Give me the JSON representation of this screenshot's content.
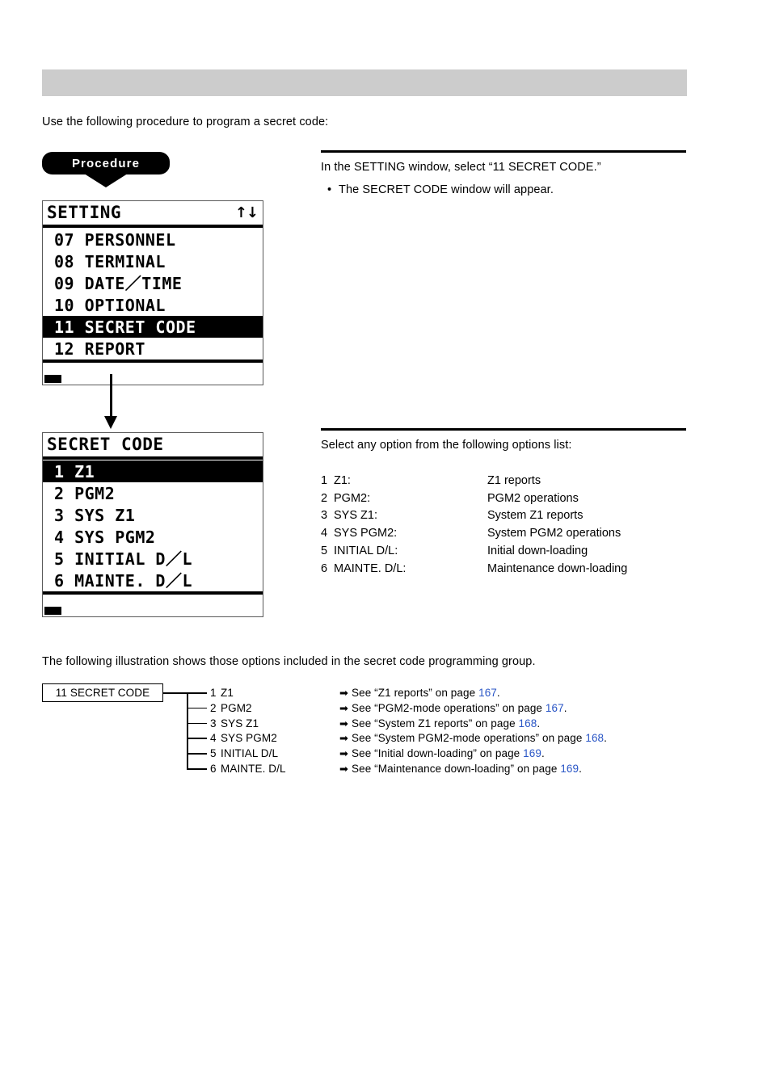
{
  "header": {
    "bar_color": "#cccccc",
    "title": ""
  },
  "intro_text": "Use the following procedure to program a secret code:",
  "procedure_badge": {
    "label": "Procedure"
  },
  "lcd_setting": {
    "title": "SETTING",
    "arrows": "↑↓",
    "rows": [
      {
        "label": "07 PERSONNEL",
        "selected": false
      },
      {
        "label": "08 TERMINAL",
        "selected": false
      },
      {
        "label": "09 DATE／TIME",
        "selected": false
      },
      {
        "label": "10 OPTIONAL",
        "selected": false
      },
      {
        "label": "11 SECRET CODE",
        "selected": true
      },
      {
        "label": "12 REPORT",
        "selected": false
      }
    ]
  },
  "lcd_secret": {
    "title": "SECRET CODE",
    "arrows": "",
    "rows": [
      {
        "label": "1 Z1",
        "selected": true
      },
      {
        "label": "2 PGM2",
        "selected": false
      },
      {
        "label": "3 SYS Z1",
        "selected": false
      },
      {
        "label": "4 SYS PGM2",
        "selected": false
      },
      {
        "label": "5 INITIAL D／L",
        "selected": false
      },
      {
        "label": "6 MAINTE. D／L",
        "selected": false
      }
    ]
  },
  "instruction_1": {
    "line": "In the SETTING window, select “11 SECRET CODE.”",
    "bullet_dot": "•",
    "bullet": "The SECRET CODE window will appear."
  },
  "instruction_2": {
    "line": "Select any option from the following options list:"
  },
  "options": [
    {
      "num": "1",
      "key": "Z1:",
      "desc": "Z1 reports"
    },
    {
      "num": "2",
      "key": "PGM2:",
      "desc": "PGM2 operations"
    },
    {
      "num": "3",
      "key": "SYS Z1:",
      "desc": "System Z1 reports"
    },
    {
      "num": "4",
      "key": "SYS PGM2:",
      "desc": "System PGM2 operations"
    },
    {
      "num": "5",
      "key": "INITIAL D/L:",
      "desc": "Initial down-loading"
    },
    {
      "num": "6",
      "key": "MAINTE. D/L:",
      "desc": "Maintenance down-loading"
    }
  ],
  "illustration_intro": "The following illustration shows those options included in the secret code programming group.",
  "tree": {
    "root_label": "11 SECRET CODE",
    "arrow_glyph": "➡",
    "branches": [
      {
        "num": "1",
        "label": "Z1",
        "ref_pre": "See “Z1 reports” on page ",
        "page": "167",
        "ref_post": "."
      },
      {
        "num": "2",
        "label": "PGM2",
        "ref_pre": "See “PGM2-mode operations” on page ",
        "page": "167",
        "ref_post": "."
      },
      {
        "num": "3",
        "label": "SYS Z1",
        "ref_pre": "See “System Z1 reports” on page ",
        "page": "168",
        "ref_post": "."
      },
      {
        "num": "4",
        "label": "SYS PGM2",
        "ref_pre": "See “System PGM2-mode operations” on page ",
        "page": "168",
        "ref_post": "."
      },
      {
        "num": "5",
        "label": "INITIAL D/L",
        "ref_pre": "See “Initial down-loading” on page ",
        "page": "169",
        "ref_post": "."
      },
      {
        "num": "6",
        "label": "MAINTE. D/L",
        "ref_pre": "See “Maintenance down-loading” on page ",
        "page": "169",
        "ref_post": "."
      }
    ]
  },
  "link_color": "#2a56c6"
}
